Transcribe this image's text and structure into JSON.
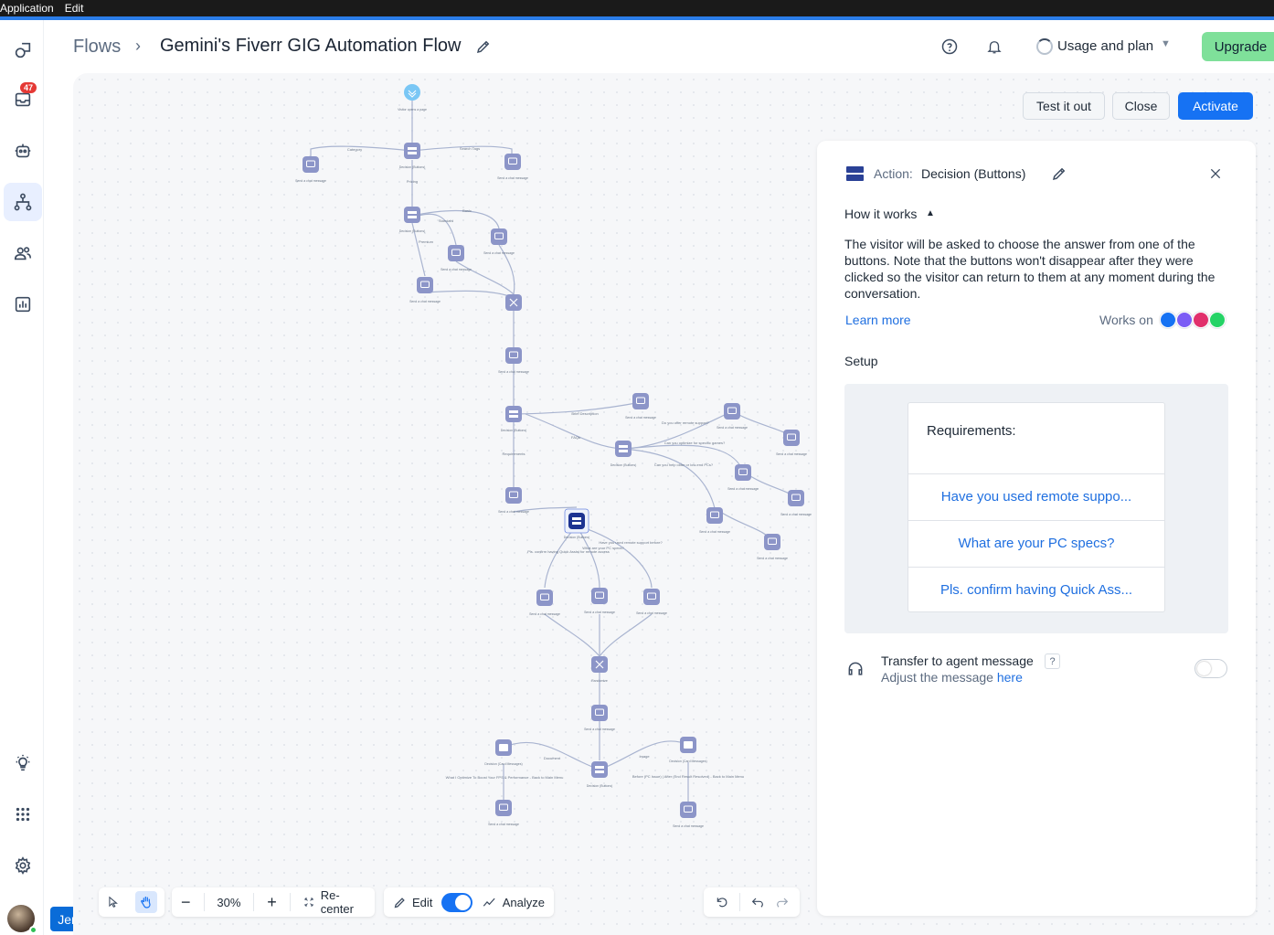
{
  "os_menu": {
    "items": [
      "Application",
      "Edit"
    ]
  },
  "sidebar": {
    "items": [
      {
        "name": "sidebar-item-dashboard",
        "icon": "shapes-icon"
      },
      {
        "name": "sidebar-item-inbox",
        "icon": "inbox-icon",
        "badge": "47"
      },
      {
        "name": "sidebar-item-bots",
        "icon": "bot-icon"
      },
      {
        "name": "sidebar-item-flows",
        "icon": "flow-icon",
        "active": true
      },
      {
        "name": "sidebar-item-contacts",
        "icon": "users-icon"
      },
      {
        "name": "sidebar-item-analytics",
        "icon": "chart-icon"
      },
      {
        "name": "sidebar-item-tips",
        "icon": "lightbulb-icon"
      },
      {
        "name": "sidebar-item-apps",
        "icon": "grid-icon"
      },
      {
        "name": "sidebar-item-settings",
        "icon": "gear-icon"
      }
    ],
    "user_name": "Jem"
  },
  "header": {
    "breadcrumb_root": "Flows",
    "breadcrumb_separator": "›",
    "flow_title": "Gemini's Fiverr GIG Automation Flow",
    "usage_label": "Usage and plan",
    "upgrade_label": "Upgrade"
  },
  "canvas_actions": {
    "test_label": "Test it out",
    "close_label": "Close",
    "activate_label": "Activate"
  },
  "panel": {
    "action_prefix": "Action:",
    "action_name": "Decision (Buttons)",
    "how_it_works": "How it works",
    "description": "The visitor will be asked to choose the answer from one of the buttons. Note that the buttons won't disappear after they were clicked so the visitor can return to them at any moment during the conversation.",
    "learn_more": "Learn more",
    "works_on": "Works on",
    "channels": [
      {
        "name": "livechat-icon",
        "color": "#1672f3"
      },
      {
        "name": "messenger-icon",
        "color": "#7b5cf5"
      },
      {
        "name": "instagram-icon",
        "color": "#e1306c"
      },
      {
        "name": "whatsapp-icon",
        "color": "#25d366"
      }
    ],
    "setup_label": "Setup",
    "preview": {
      "message": "Requirements:",
      "buttons": [
        "Have you used remote suppo...",
        "What are your PC specs?",
        "Pls. confirm having Quick Ass..."
      ]
    },
    "agent": {
      "title": "Transfer to agent message",
      "help": "?",
      "sub_prefix": "Adjust the message",
      "sub_link": "here",
      "enabled": false
    }
  },
  "toolbar": {
    "zoom": "30%",
    "zoom_out": "−",
    "zoom_in": "+",
    "recenter": "Re-center",
    "edit": "Edit",
    "analyze": "Analyze",
    "edit_mode_on": true
  },
  "flow": {
    "start_label": "Visitor opens a page",
    "decision_label": "Decision (Buttons)",
    "send_label": "Send a chat message",
    "randomize_label": "Randomize",
    "card_label": "Decision (Card Messages)",
    "edge_labels": [
      "Category",
      "Search Tags",
      "Pricing",
      "Basic",
      "Standard",
      "Premium",
      "Brief Description",
      "FAQs",
      "Requirements",
      "Do you offer remote support?",
      "Can you optimize for specific games?",
      "Can you help older or low-end PCs?",
      "Have you used remote support before?",
      "What are your PC specs?",
      "Pls. confirm having Quick Assist for remote access",
      "Document",
      "Image",
      "What I Optimize To Boost Your FPS & Performance - Back to Main Menu",
      "Before (PC Issue) | After (End Result Resolved) - Back to Main Menu"
    ]
  }
}
